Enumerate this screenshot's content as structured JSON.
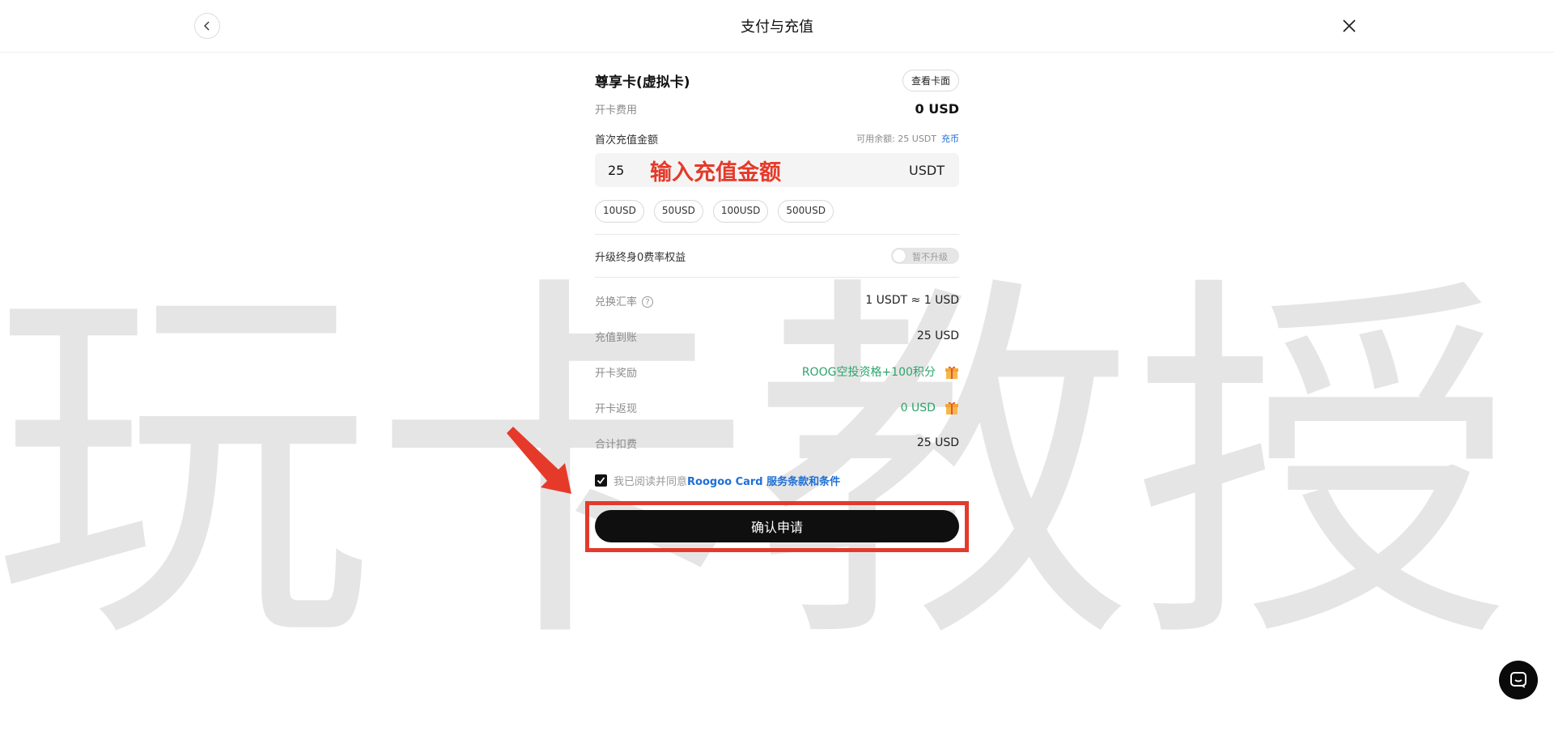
{
  "header": {
    "title": "支付与充值"
  },
  "card": {
    "name": "尊享卡(虚拟卡)",
    "view_button": "查看卡面",
    "fee_label": "开卡费用",
    "fee_value": "0 USD"
  },
  "topup": {
    "label": "首次充值金额",
    "balance_text": "可用余额: 25 USDT",
    "recharge_link": "充币",
    "amount_value": "25",
    "amount_hint": "输入充值金额",
    "unit": "USDT",
    "presets": [
      "10USD",
      "50USD",
      "100USD",
      "500USD"
    ]
  },
  "upgrade": {
    "label": "升级终身0费率权益",
    "toggle_label": "暂不升级"
  },
  "details": {
    "rate_label": "兑换汇率",
    "rate_value": "1 USDT ≈ 1 USD",
    "credited_label": "充值到账",
    "credited_value": "25 USD",
    "reward_label": "开卡奖励",
    "reward_value": "ROOG空投资格+100积分",
    "cashback_label": "开卡返现",
    "cashback_value": "0 USD",
    "total_label": "合计扣费",
    "total_value": "25 USD"
  },
  "agreement": {
    "prefix": "我已阅读并同意",
    "link": "Roogoo Card 服务条款和条件"
  },
  "confirm_button": "确认申请",
  "watermark": "玩卡教授",
  "colors": {
    "accent_red": "#e53a2a",
    "link_blue": "#1f6fd6",
    "green": "#2aa56b",
    "button_black": "#0f0f0f"
  },
  "icons": {
    "back": "chevron-left-icon",
    "close": "close-icon",
    "help": "question-circle-icon",
    "gift": "gift-icon",
    "check": "check-icon",
    "chat": "chat-icon"
  }
}
